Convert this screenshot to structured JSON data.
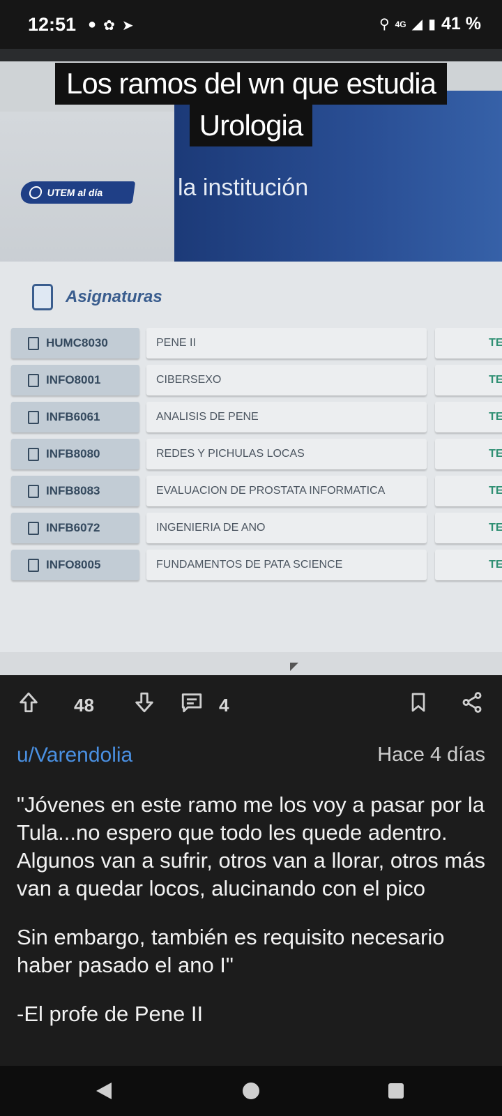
{
  "status_bar": {
    "time": "12:51",
    "network": "4G",
    "battery": "41 %"
  },
  "image": {
    "caption_line1": "Los ramos del wn que estudia",
    "caption_line2": "Urologia",
    "logo_text": "UTEM al día",
    "banner_text": "la institución",
    "section_title": "Asignaturas",
    "courses": [
      {
        "code": "HUMC8030",
        "name": "PENE II",
        "type": "TEO"
      },
      {
        "code": "INFO8001",
        "name": "CIBERSEXO",
        "type": "TEO"
      },
      {
        "code": "INFB6061",
        "name": "ANALISIS DE PENE",
        "type": "TEO"
      },
      {
        "code": "INFB8080",
        "name": "REDES Y PICHULAS LOCAS",
        "type": "TEO"
      },
      {
        "code": "INFB8083",
        "name": "EVALUACION DE PROSTATA INFORMATICA",
        "type": "TEO"
      },
      {
        "code": "INFB6072",
        "name": "INGENIERIA DE ANO",
        "type": "TEO"
      },
      {
        "code": "INFO8005",
        "name": "FUNDAMENTOS DE PATA SCIENCE",
        "type": "TEO"
      }
    ]
  },
  "actions": {
    "score": "48",
    "comment_count": "4"
  },
  "post": {
    "author": "u/Varendolia",
    "time_ago": "Hace 4 días",
    "paragraphs": [
      "\"Jóvenes en este ramo me los voy a pasar por la Tula...no espero que todo les quede adentro. Algunos van a sufrir, otros van a llorar, otros más van a quedar locos, alucinando con el pico",
      "Sin embargo, también es requisito necesario haber pasado el ano I\"",
      "-El profe de Pene II"
    ]
  },
  "colors": {
    "author_link": "#4a90e2",
    "background": "#1c1c1c",
    "banner_blue": "#1c3a78"
  }
}
